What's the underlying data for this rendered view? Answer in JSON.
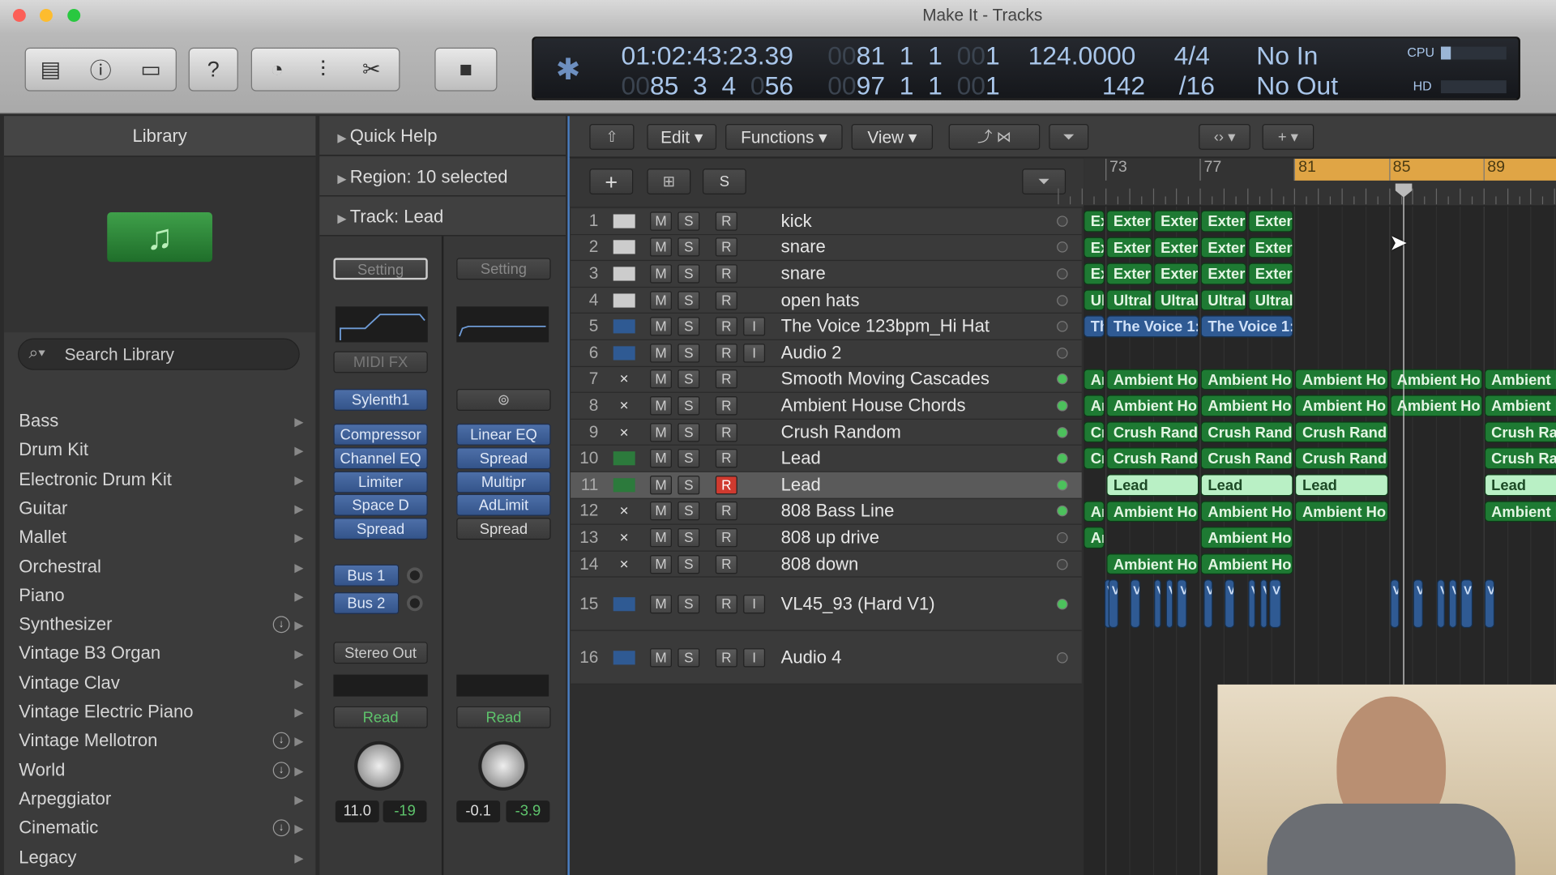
{
  "window": {
    "title": "Make It - Tracks"
  },
  "toolbar": {
    "icons": [
      "library-icon",
      "info-icon",
      "toolbar-icon",
      "help-icon",
      "tuner-icon",
      "mixer-icon",
      "editors-icon",
      "stop-icon"
    ]
  },
  "lcd": {
    "time": "01:02:43:23.39",
    "pos_bar": "81",
    "pos_beat": "1",
    "pos_div": "1",
    "pos_tick_dim": "00",
    "pos_tick": "1",
    "pos_bar_dim": "00",
    "loc_bar": "85",
    "loc_beat": "3",
    "loc_div": "4",
    "loc_tick": "56",
    "end_bar": "97",
    "end_beat": "1",
    "end_div": "1",
    "end_tick": "1",
    "tempo": "124.0000",
    "tempo2": "142",
    "sig": "4/4",
    "div": "/16",
    "in": "No In",
    "out": "No Out",
    "cpu": "CPU",
    "hd": "HD",
    "cpu_level": 0.15
  },
  "library": {
    "title": "Library",
    "search_placeholder": "Search Library",
    "items": [
      {
        "label": "Bass"
      },
      {
        "label": "Drum Kit"
      },
      {
        "label": "Electronic Drum Kit"
      },
      {
        "label": "Guitar"
      },
      {
        "label": "Mallet"
      },
      {
        "label": "Orchestral"
      },
      {
        "label": "Piano"
      },
      {
        "label": "Synthesizer",
        "download": true
      },
      {
        "label": "Vintage B3 Organ"
      },
      {
        "label": "Vintage Clav"
      },
      {
        "label": "Vintage Electric Piano"
      },
      {
        "label": "Vintage Mellotron",
        "download": true
      },
      {
        "label": "World",
        "download": true
      },
      {
        "label": "Arpeggiator"
      },
      {
        "label": "Cinematic",
        "download": true
      },
      {
        "label": "Legacy"
      }
    ]
  },
  "inspector": {
    "quick_help": "Quick Help",
    "region": "Region: 10 selected",
    "track": "Track:  Lead",
    "strip1": {
      "setting": "Setting",
      "midi_fx": "MIDI FX",
      "instrument": "Sylenth1",
      "fx": [
        "Compressor",
        "Channel EQ",
        "Limiter",
        "Space D",
        "Spread"
      ],
      "sends": [
        "Bus 1",
        "Bus 2"
      ],
      "output": "Stereo Out",
      "automation": "Read",
      "volume": "11.0",
      "peak": "-19"
    },
    "strip2": {
      "setting": "Setting",
      "fx": [
        "Linear EQ",
        "Spread",
        "Multipr",
        "AdLimit",
        "Spread"
      ],
      "automation": "Read",
      "volume": "-0.1",
      "peak": "-3.9"
    }
  },
  "tracks_toolbar": {
    "edit": "Edit",
    "functions": "Functions",
    "view": "View",
    "add": "+",
    "solo": "S"
  },
  "ruler": {
    "bars": [
      "73",
      "77",
      "81",
      "85",
      "89"
    ],
    "cycle": [
      81,
      93
    ],
    "playhead_bar": 85.5
  },
  "tracks": [
    {
      "n": "1",
      "name": "kick",
      "type": "drum",
      "regions": [
        [
          71,
          2,
          "Exten"
        ],
        [
          73,
          2,
          "Exter"
        ],
        [
          75,
          2,
          "Exten"
        ],
        [
          77,
          2,
          "Exter"
        ],
        [
          79,
          2,
          "Exten"
        ]
      ],
      "color": "green"
    },
    {
      "n": "2",
      "name": "snare",
      "type": "drum",
      "regions": [
        [
          71,
          2,
          "Exten"
        ],
        [
          73,
          2,
          "Exter"
        ],
        [
          75,
          2,
          "Exten"
        ],
        [
          77,
          2,
          "Exter"
        ],
        [
          79,
          2,
          "Exten"
        ]
      ],
      "color": "green"
    },
    {
      "n": "3",
      "name": "snare",
      "type": "drum",
      "regions": [
        [
          71,
          2,
          "Exten"
        ],
        [
          73,
          2,
          "Exter"
        ],
        [
          75,
          2,
          "Exten"
        ],
        [
          77,
          2,
          "Exter"
        ],
        [
          79,
          2,
          "Exten"
        ]
      ],
      "color": "green"
    },
    {
      "n": "4",
      "name": "open hats",
      "type": "drum",
      "regions": [
        [
          71,
          2,
          "Ultral"
        ],
        [
          73,
          2,
          "Ultral"
        ],
        [
          75,
          2,
          "Ultral"
        ],
        [
          77,
          2,
          "Ultral"
        ],
        [
          79,
          2,
          "Ultral"
        ]
      ],
      "color": "green"
    },
    {
      "n": "5",
      "name": "The Voice 123bpm_Hi Hat",
      "type": "audio",
      "input": true,
      "regions": [
        [
          71,
          2,
          "The Voice 1:"
        ],
        [
          73,
          4,
          "The Voice 1:"
        ],
        [
          77,
          4,
          "The Voice 1:"
        ]
      ],
      "color": "blue"
    },
    {
      "n": "6",
      "name": "Audio 2",
      "type": "audio",
      "input": true,
      "regions": [],
      "color": "blue"
    },
    {
      "n": "7",
      "name": "Smooth Moving Cascades",
      "type": "synth",
      "active": true,
      "regions": [
        [
          71,
          2,
          "Ambient Ho"
        ],
        [
          73,
          4,
          "Ambient Ho"
        ],
        [
          77,
          4,
          "Ambient Ho"
        ],
        [
          81,
          4,
          "Ambient Ho"
        ],
        [
          85,
          4,
          "Ambient Ho"
        ],
        [
          89,
          4,
          "Ambient Ho"
        ]
      ],
      "color": "green"
    },
    {
      "n": "8",
      "name": "Ambient House Chords",
      "type": "synth",
      "active": true,
      "regions": [
        [
          71,
          2,
          "Ambient Ho"
        ],
        [
          73,
          4,
          "Ambient Ho"
        ],
        [
          77,
          4,
          "Ambient Ho"
        ],
        [
          81,
          4,
          "Ambient Ho"
        ],
        [
          85,
          4,
          "Ambient Ho"
        ],
        [
          89,
          4,
          "Ambient Ho"
        ]
      ],
      "color": "green"
    },
    {
      "n": "9",
      "name": "Crush Random",
      "type": "synth",
      "active": true,
      "regions": [
        [
          71,
          2,
          "Crush Rand"
        ],
        [
          73,
          4,
          "Crush Rand"
        ],
        [
          77,
          4,
          "Crush Rand"
        ],
        [
          81,
          4,
          "Crush Rand"
        ],
        [
          89,
          4,
          "Crush Rand"
        ]
      ],
      "color": "green"
    },
    {
      "n": "10",
      "name": "Lead",
      "type": "keys",
      "active": true,
      "regions": [
        [
          71,
          2,
          "Crush Rand"
        ],
        [
          73,
          4,
          "Crush Rand"
        ],
        [
          77,
          4,
          "Crush Rand"
        ],
        [
          81,
          4,
          "Crush Rand"
        ],
        [
          89,
          4,
          "Crush Rand"
        ]
      ],
      "color": "green"
    },
    {
      "n": "11",
      "name": "Lead",
      "type": "keys",
      "active": true,
      "selected": true,
      "record": true,
      "regions": [
        [
          73,
          4,
          "Lead"
        ],
        [
          77,
          4,
          "Lead"
        ],
        [
          81,
          4,
          "Lead"
        ],
        [
          89,
          4,
          "Lead"
        ]
      ],
      "color": "lightgreen"
    },
    {
      "n": "12",
      "name": "808 Bass Line",
      "type": "synth",
      "active": true,
      "regions": [
        [
          71,
          2,
          "Ambient Ho"
        ],
        [
          73,
          4,
          "Ambient Ho"
        ],
        [
          77,
          4,
          "Ambient Ho"
        ],
        [
          81,
          4,
          "Ambient Ho"
        ],
        [
          89,
          4,
          "Ambient Ho"
        ]
      ],
      "color": "green"
    },
    {
      "n": "13",
      "name": "808 up drive",
      "type": "synth",
      "regions": [
        [
          71,
          2,
          "Ambient Ho"
        ],
        [
          77,
          4,
          "Ambient Ho"
        ]
      ],
      "color": "green"
    },
    {
      "n": "14",
      "name": "808 down",
      "type": "synth",
      "regions": [
        [
          73,
          4,
          "Ambient Ho"
        ],
        [
          77,
          4,
          "Ambient Ho"
        ]
      ],
      "color": "green"
    },
    {
      "n": "15",
      "name": "VL45_93 (Hard V1)",
      "type": "audio",
      "input": true,
      "active": true,
      "tall": true,
      "regions": [
        [
          72.9,
          0.4,
          "V"
        ],
        [
          73.1,
          0.5,
          "V"
        ],
        [
          74,
          0.5,
          "V"
        ],
        [
          75,
          0.4,
          "V"
        ],
        [
          75.5,
          0.4,
          "V"
        ],
        [
          76,
          0.5,
          "V"
        ],
        [
          77.1,
          0.5,
          "V"
        ],
        [
          78,
          0.5,
          "V"
        ],
        [
          79,
          0.4,
          "V"
        ],
        [
          79.5,
          0.4,
          "V"
        ],
        [
          79.9,
          0.6,
          "V"
        ],
        [
          85,
          0.5,
          "V"
        ],
        [
          86,
          0.5,
          "V"
        ],
        [
          87,
          0.4,
          "V"
        ],
        [
          87.5,
          0.4,
          "V"
        ],
        [
          88,
          0.6,
          "V"
        ],
        [
          89,
          0.5,
          "V"
        ]
      ],
      "color": "blue"
    },
    {
      "n": "16",
      "name": "Audio 4",
      "type": "audio",
      "input": true,
      "tall": true,
      "regions": [],
      "color": "blue"
    }
  ],
  "track_buttons": {
    "mute": "M",
    "solo": "S",
    "record": "R",
    "input": "I"
  },
  "colors": {
    "green": "#1e7a33",
    "lightgreen": "#b9f0c5",
    "blue": "#2f5a93",
    "cycle": "#e0a545",
    "record": "#d03a2f"
  }
}
